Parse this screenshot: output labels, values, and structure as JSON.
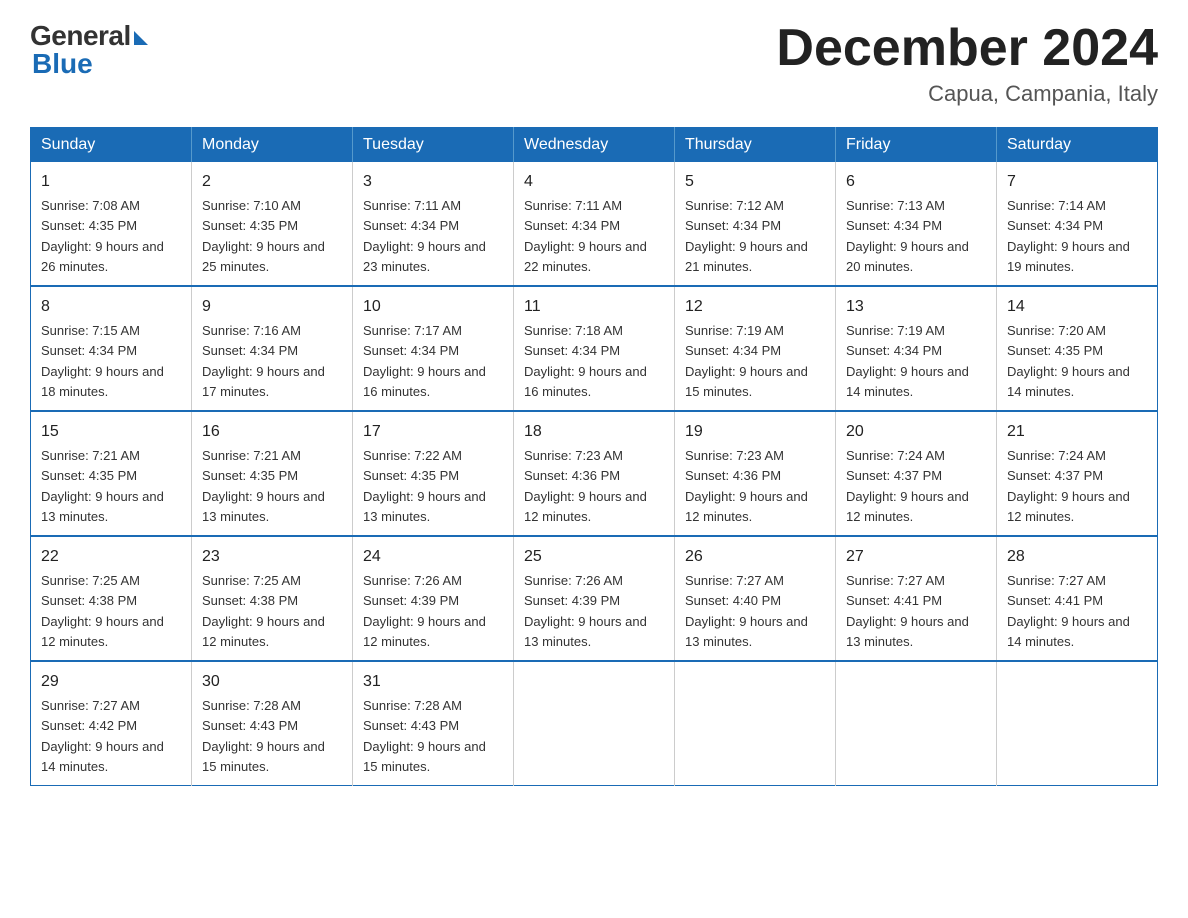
{
  "header": {
    "logo_general": "General",
    "logo_blue": "Blue",
    "month_title": "December 2024",
    "location": "Capua, Campania, Italy"
  },
  "weekdays": [
    "Sunday",
    "Monday",
    "Tuesday",
    "Wednesday",
    "Thursday",
    "Friday",
    "Saturday"
  ],
  "weeks": [
    [
      {
        "day": "1",
        "sunrise": "7:08 AM",
        "sunset": "4:35 PM",
        "daylight": "9 hours and 26 minutes."
      },
      {
        "day": "2",
        "sunrise": "7:10 AM",
        "sunset": "4:35 PM",
        "daylight": "9 hours and 25 minutes."
      },
      {
        "day": "3",
        "sunrise": "7:11 AM",
        "sunset": "4:34 PM",
        "daylight": "9 hours and 23 minutes."
      },
      {
        "day": "4",
        "sunrise": "7:11 AM",
        "sunset": "4:34 PM",
        "daylight": "9 hours and 22 minutes."
      },
      {
        "day": "5",
        "sunrise": "7:12 AM",
        "sunset": "4:34 PM",
        "daylight": "9 hours and 21 minutes."
      },
      {
        "day": "6",
        "sunrise": "7:13 AM",
        "sunset": "4:34 PM",
        "daylight": "9 hours and 20 minutes."
      },
      {
        "day": "7",
        "sunrise": "7:14 AM",
        "sunset": "4:34 PM",
        "daylight": "9 hours and 19 minutes."
      }
    ],
    [
      {
        "day": "8",
        "sunrise": "7:15 AM",
        "sunset": "4:34 PM",
        "daylight": "9 hours and 18 minutes."
      },
      {
        "day": "9",
        "sunrise": "7:16 AM",
        "sunset": "4:34 PM",
        "daylight": "9 hours and 17 minutes."
      },
      {
        "day": "10",
        "sunrise": "7:17 AM",
        "sunset": "4:34 PM",
        "daylight": "9 hours and 16 minutes."
      },
      {
        "day": "11",
        "sunrise": "7:18 AM",
        "sunset": "4:34 PM",
        "daylight": "9 hours and 16 minutes."
      },
      {
        "day": "12",
        "sunrise": "7:19 AM",
        "sunset": "4:34 PM",
        "daylight": "9 hours and 15 minutes."
      },
      {
        "day": "13",
        "sunrise": "7:19 AM",
        "sunset": "4:34 PM",
        "daylight": "9 hours and 14 minutes."
      },
      {
        "day": "14",
        "sunrise": "7:20 AM",
        "sunset": "4:35 PM",
        "daylight": "9 hours and 14 minutes."
      }
    ],
    [
      {
        "day": "15",
        "sunrise": "7:21 AM",
        "sunset": "4:35 PM",
        "daylight": "9 hours and 13 minutes."
      },
      {
        "day": "16",
        "sunrise": "7:21 AM",
        "sunset": "4:35 PM",
        "daylight": "9 hours and 13 minutes."
      },
      {
        "day": "17",
        "sunrise": "7:22 AM",
        "sunset": "4:35 PM",
        "daylight": "9 hours and 13 minutes."
      },
      {
        "day": "18",
        "sunrise": "7:23 AM",
        "sunset": "4:36 PM",
        "daylight": "9 hours and 12 minutes."
      },
      {
        "day": "19",
        "sunrise": "7:23 AM",
        "sunset": "4:36 PM",
        "daylight": "9 hours and 12 minutes."
      },
      {
        "day": "20",
        "sunrise": "7:24 AM",
        "sunset": "4:37 PM",
        "daylight": "9 hours and 12 minutes."
      },
      {
        "day": "21",
        "sunrise": "7:24 AM",
        "sunset": "4:37 PM",
        "daylight": "9 hours and 12 minutes."
      }
    ],
    [
      {
        "day": "22",
        "sunrise": "7:25 AM",
        "sunset": "4:38 PM",
        "daylight": "9 hours and 12 minutes."
      },
      {
        "day": "23",
        "sunrise": "7:25 AM",
        "sunset": "4:38 PM",
        "daylight": "9 hours and 12 minutes."
      },
      {
        "day": "24",
        "sunrise": "7:26 AM",
        "sunset": "4:39 PM",
        "daylight": "9 hours and 12 minutes."
      },
      {
        "day": "25",
        "sunrise": "7:26 AM",
        "sunset": "4:39 PM",
        "daylight": "9 hours and 13 minutes."
      },
      {
        "day": "26",
        "sunrise": "7:27 AM",
        "sunset": "4:40 PM",
        "daylight": "9 hours and 13 minutes."
      },
      {
        "day": "27",
        "sunrise": "7:27 AM",
        "sunset": "4:41 PM",
        "daylight": "9 hours and 13 minutes."
      },
      {
        "day": "28",
        "sunrise": "7:27 AM",
        "sunset": "4:41 PM",
        "daylight": "9 hours and 14 minutes."
      }
    ],
    [
      {
        "day": "29",
        "sunrise": "7:27 AM",
        "sunset": "4:42 PM",
        "daylight": "9 hours and 14 minutes."
      },
      {
        "day": "30",
        "sunrise": "7:28 AM",
        "sunset": "4:43 PM",
        "daylight": "9 hours and 15 minutes."
      },
      {
        "day": "31",
        "sunrise": "7:28 AM",
        "sunset": "4:43 PM",
        "daylight": "9 hours and 15 minutes."
      },
      null,
      null,
      null,
      null
    ]
  ]
}
